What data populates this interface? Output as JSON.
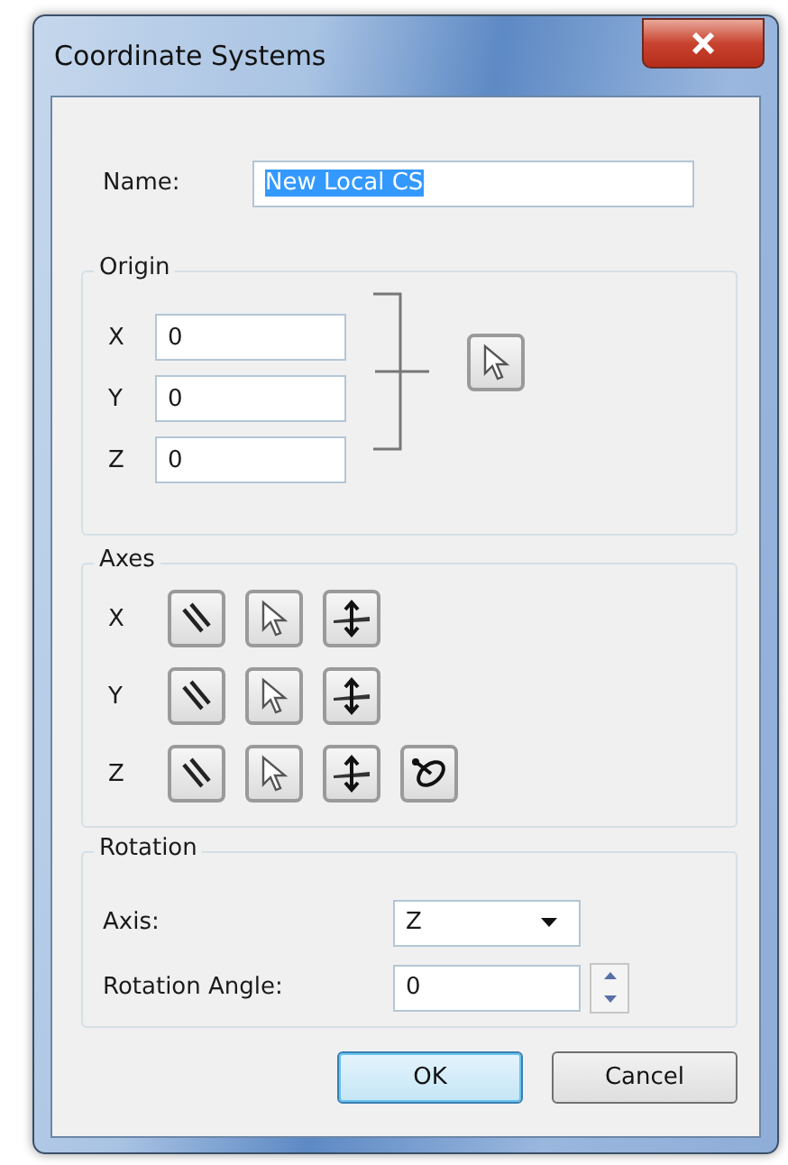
{
  "window": {
    "title": "Coordinate Systems"
  },
  "name": {
    "label": "Name:",
    "value": "New Local CS",
    "selected": true
  },
  "origin": {
    "title": "Origin",
    "fields": [
      {
        "label": "X",
        "value": "0"
      },
      {
        "label": "Y",
        "value": "0"
      },
      {
        "label": "Z",
        "value": "0"
      }
    ]
  },
  "axes": {
    "title": "Axes",
    "rows": [
      {
        "label": "X",
        "tools": [
          {
            "kind": "line"
          },
          {
            "kind": "pick"
          },
          {
            "kind": "normal"
          }
        ]
      },
      {
        "label": "Y",
        "tools": [
          {
            "kind": "line"
          },
          {
            "kind": "pick"
          },
          {
            "kind": "normal"
          }
        ]
      },
      {
        "label": "Z",
        "tools": [
          {
            "kind": "line"
          },
          {
            "kind": "pick"
          },
          {
            "kind": "normal"
          },
          {
            "kind": "orbit"
          }
        ]
      }
    ]
  },
  "rotation": {
    "title": "Rotation",
    "axis_label": "Axis:",
    "axis_value": "Z",
    "angle_label": "Rotation Angle:",
    "angle_value": "0"
  },
  "buttons": [
    {
      "label": "OK",
      "default": true
    },
    {
      "label": "Cancel",
      "default": false
    }
  ]
}
